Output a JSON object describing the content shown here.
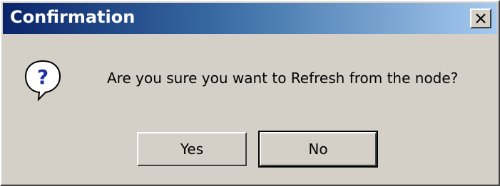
{
  "dialog": {
    "title": "Confirmation",
    "message": "Are you sure you want to Refresh from the node?",
    "icon": "question-icon"
  },
  "buttons": {
    "yes_label": "Yes",
    "no_label": "No"
  },
  "colors": {
    "titlebar_start": "#0a246a",
    "titlebar_end": "#a6caf0",
    "face": "#d4d0c8"
  }
}
